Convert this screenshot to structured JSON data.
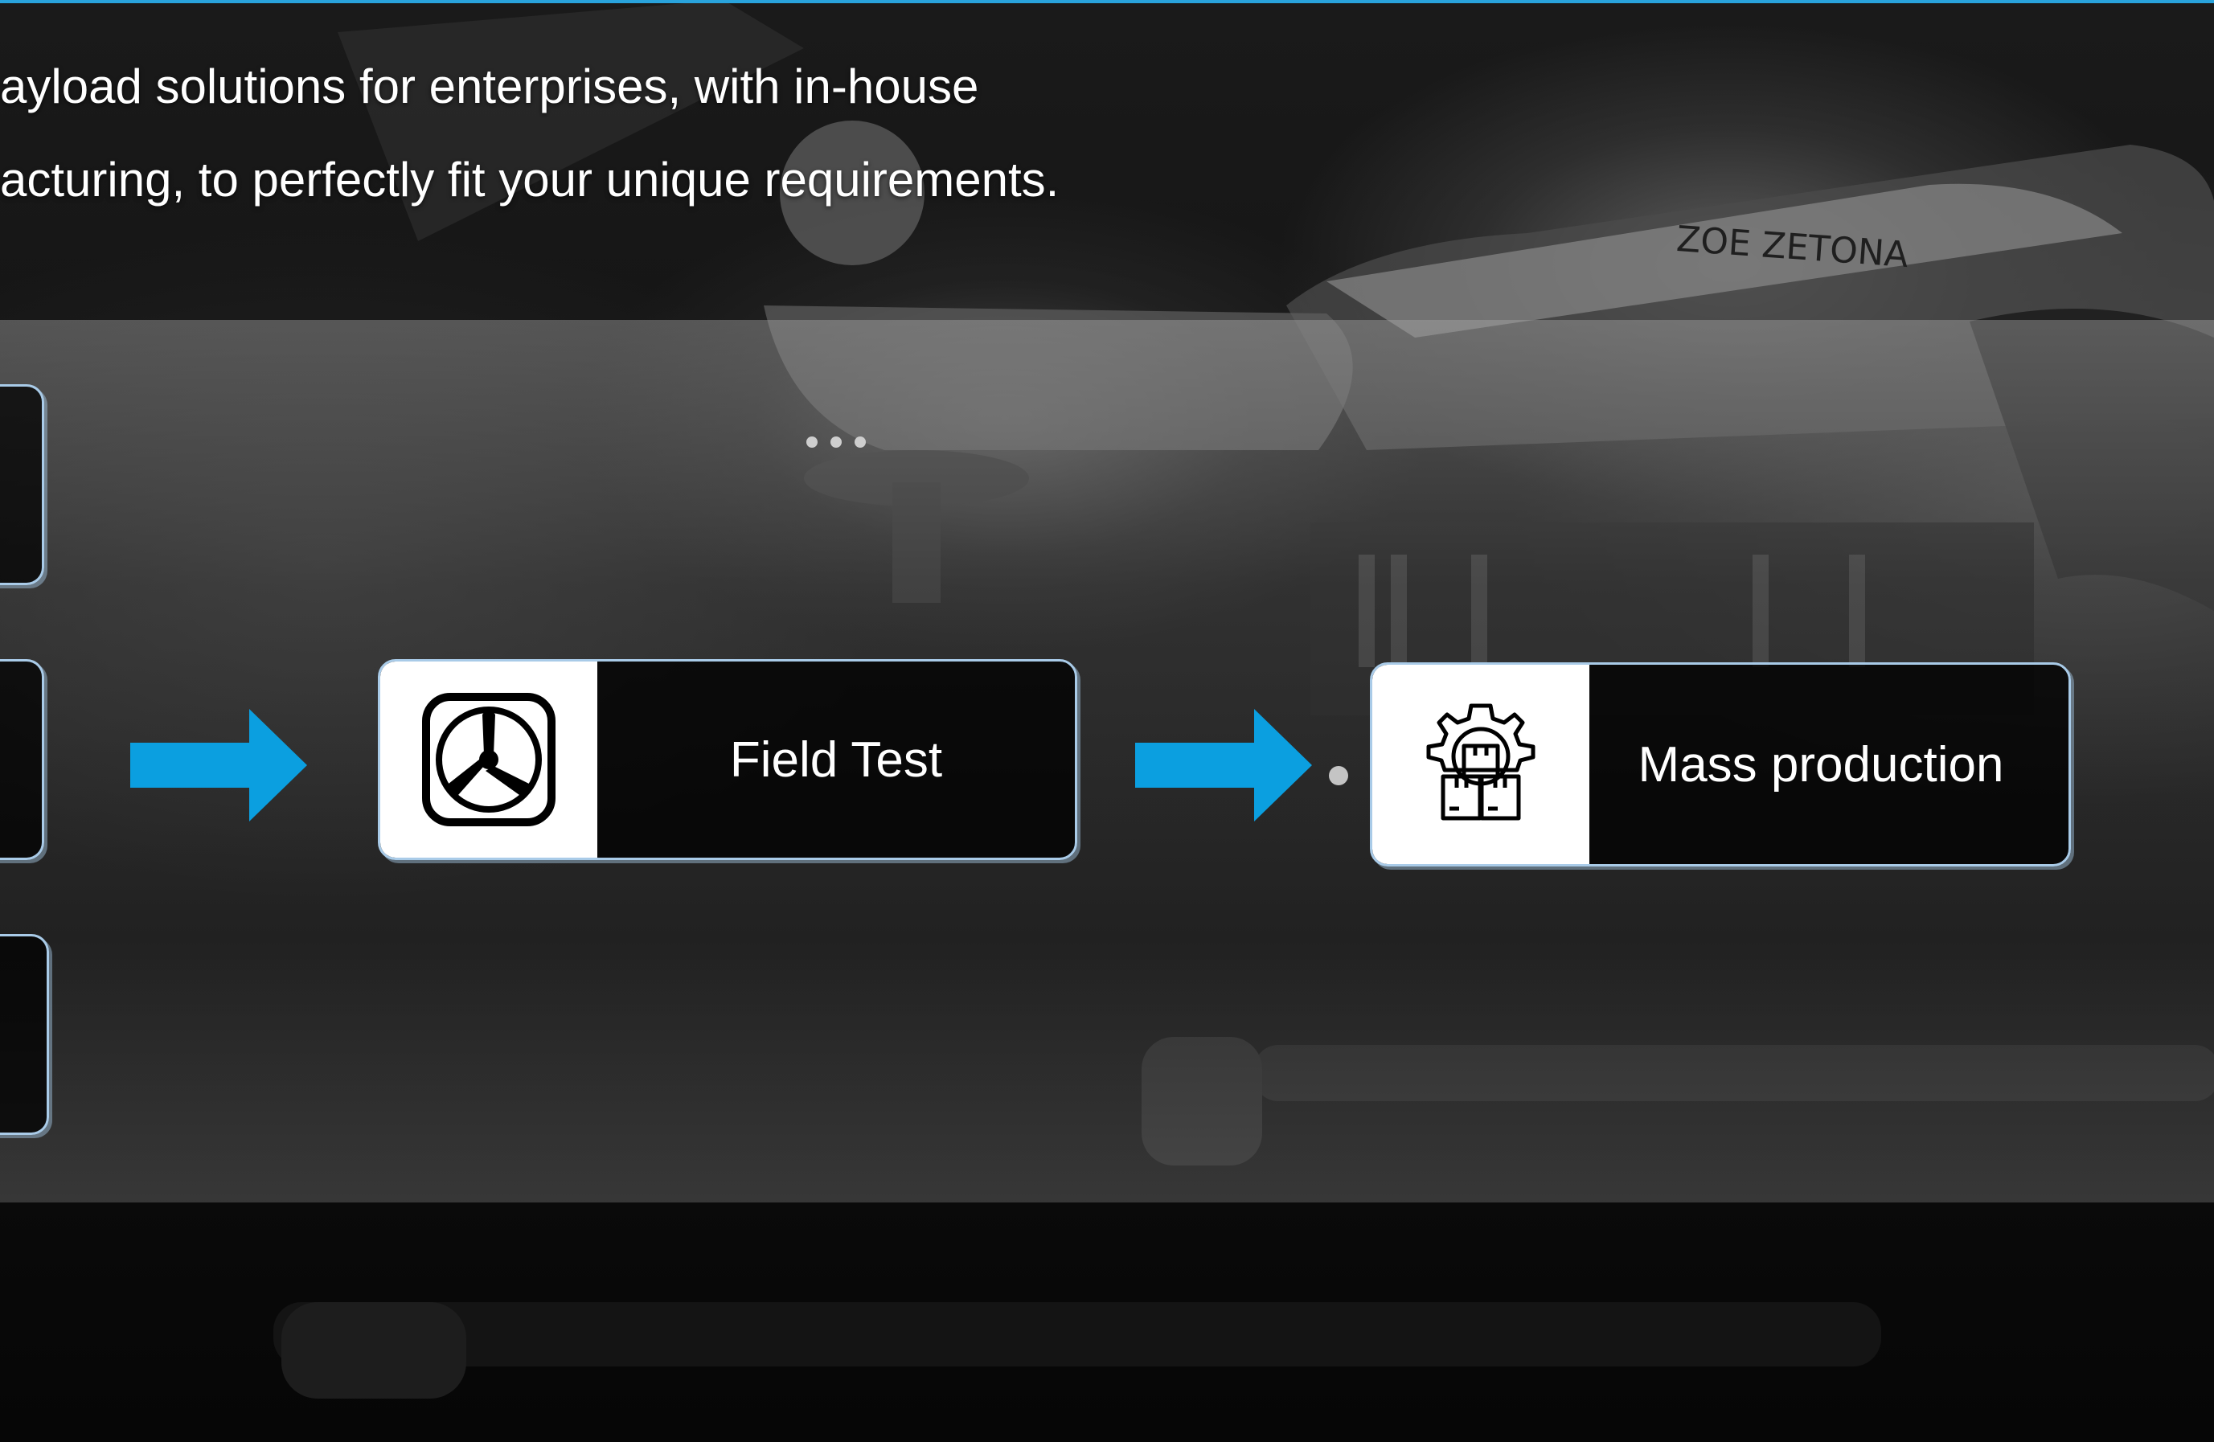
{
  "intro": {
    "line1": "ayload solutions for enterprises, with in-house",
    "line2": "acturing, to perfectly fit your unique requirements."
  },
  "background": {
    "drone_marking": "ZOE ZETONA"
  },
  "process": {
    "steps": [
      {
        "label": "Field Test",
        "icon": "propeller-icon"
      },
      {
        "label": "Mass production",
        "icon": "manufacturing-boxes-gear-icon"
      }
    ],
    "arrow_color": "#0b9fe0",
    "border_color": "#a9cbe8"
  },
  "colors": {
    "accent_line": "#29a3dc"
  }
}
